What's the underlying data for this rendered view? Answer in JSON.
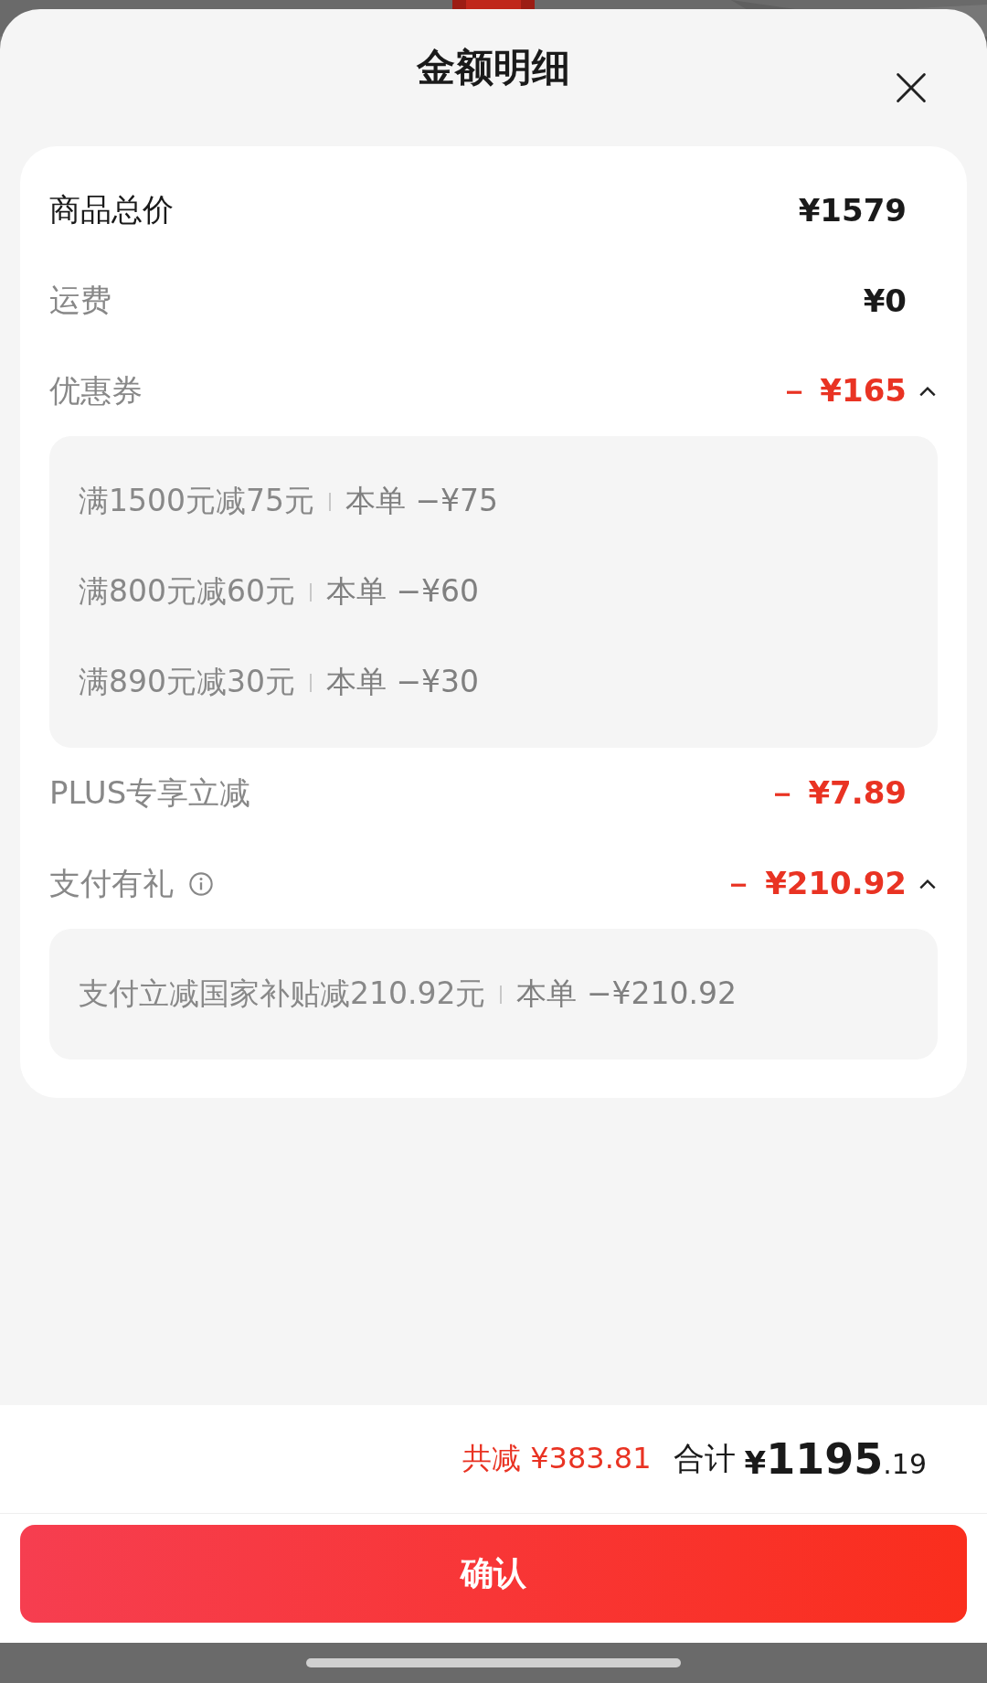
{
  "sheet": {
    "title": "金额明细"
  },
  "rows": [
    {
      "label": "商品总价",
      "highlighted": true,
      "amount": "¥1579",
      "discount": false
    },
    {
      "label": "运费",
      "highlighted": false,
      "amount": "¥0",
      "discount": false
    },
    {
      "label": "优惠券",
      "highlighted": false,
      "amount": "－ ¥165",
      "discount": true,
      "expanded": true,
      "details": [
        {
          "condition": "满1500元减75元",
          "deduction": "本单 −¥75"
        },
        {
          "condition": "满800元减60元",
          "deduction": "本单 −¥60"
        },
        {
          "condition": "满890元减30元",
          "deduction": "本单 −¥30"
        }
      ]
    },
    {
      "label": "PLUS专享立减",
      "highlighted": false,
      "amount": "－ ¥7.89",
      "discount": true
    },
    {
      "label": "支付有礼",
      "highlighted": false,
      "info": true,
      "amount": "－ ¥210.92",
      "discount": true,
      "expanded": true,
      "details": [
        {
          "condition": "支付立减国家补贴减210.92元",
          "deduction": "本单 −¥210.92"
        }
      ]
    }
  ],
  "summary": {
    "saved": "共减 ¥383.81",
    "total_label": "合计",
    "total_currency": "¥",
    "total_integer": "1195",
    "total_decimal": ".19"
  },
  "confirm_button": "确认"
}
